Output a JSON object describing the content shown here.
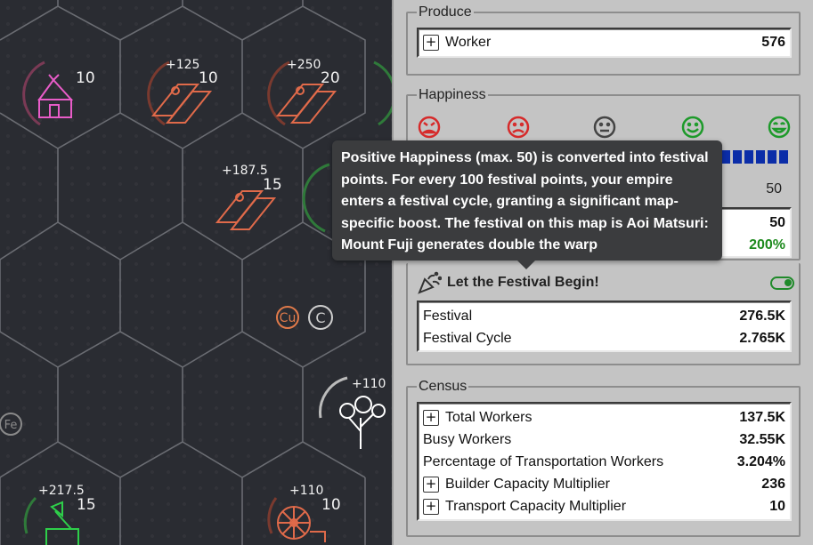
{
  "map": {
    "tiles": [
      {
        "id": "hut",
        "bonus": "",
        "level": "10"
      },
      {
        "id": "lumber-1",
        "bonus": "+125",
        "level": "10"
      },
      {
        "id": "lumber-2",
        "bonus": "+250",
        "level": "20"
      },
      {
        "id": "lumber-3",
        "bonus": "+187.5",
        "level": "15"
      },
      {
        "id": "tree",
        "bonus": "+110",
        "level": ""
      },
      {
        "id": "stump",
        "bonus": "+217.5",
        "level": "15"
      },
      {
        "id": "spinning-wheel",
        "bonus": "+110",
        "level": "10"
      }
    ],
    "resources": [
      "Cu",
      "C",
      "Fe"
    ]
  },
  "produce": {
    "legend": "Produce",
    "rows": [
      {
        "label": "Worker",
        "value": "576",
        "expandable": true
      }
    ]
  },
  "happiness": {
    "legend": "Happiness",
    "faces": [
      "very-angry-face-icon",
      "sad-face-icon",
      "neutral-face-icon",
      "happy-face-icon",
      "very-happy-face-icon"
    ],
    "face_colors": [
      "#d62a2a",
      "#d62a2a",
      "#444444",
      "#1d9a2a",
      "#1d9a2a"
    ],
    "bar_color": "#0b2da8",
    "bar_value": "50",
    "stats": [
      {
        "value": "50"
      },
      {
        "value": "200%",
        "color": "#1d8a1d"
      }
    ]
  },
  "tooltip": {
    "text": "Positive Happiness (max. 50) is converted into festival points. For every 100 festival points, your empire enters a festival cycle, granting a significant map-specific boost. The festival on this map is Aoi Matsuri: Mount Fuji generates double the warp"
  },
  "festival": {
    "title": "Let the Festival Begin!",
    "toggle_on": true,
    "rows": [
      {
        "label": "Festival",
        "value": "276.5K"
      },
      {
        "label": "Festival Cycle",
        "value": "2.765K"
      }
    ]
  },
  "census": {
    "legend": "Census",
    "rows": [
      {
        "label": "Total Workers",
        "value": "137.5K",
        "expandable": true
      },
      {
        "label": "Busy Workers",
        "value": "32.55K",
        "expandable": false
      },
      {
        "label": "Percentage of Transportation Workers",
        "value": "3.204%",
        "expandable": false
      },
      {
        "label": "Builder Capacity Multiplier",
        "value": "236",
        "expandable": true
      },
      {
        "label": "Transport Capacity Multiplier",
        "value": "10",
        "expandable": true
      }
    ]
  }
}
